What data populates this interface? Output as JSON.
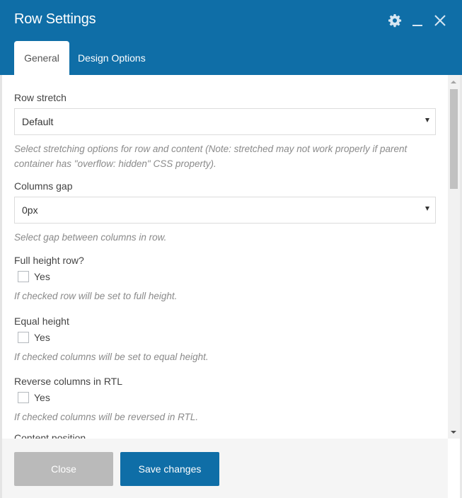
{
  "window": {
    "title": "Row Settings",
    "icons": [
      "gear-icon",
      "minimize-icon",
      "close-icon"
    ]
  },
  "tabs": [
    {
      "label": "General",
      "active": true
    },
    {
      "label": "Design Options",
      "active": false
    }
  ],
  "fields": {
    "row_stretch": {
      "label": "Row stretch",
      "value": "Default",
      "hint": "Select stretching options for row and content (Note: stretched may not work properly if parent container has \"overflow: hidden\" CSS property)."
    },
    "columns_gap": {
      "label": "Columns gap",
      "value": "0px",
      "hint": "Select gap between columns in row."
    },
    "full_height": {
      "label": "Full height row?",
      "option": "Yes",
      "checked": false,
      "hint": "If checked row will be set to full height."
    },
    "equal_height": {
      "label": "Equal height",
      "option": "Yes",
      "checked": false,
      "hint": "If checked columns will be set to equal height."
    },
    "reverse_rtl": {
      "label": "Reverse columns in RTL",
      "option": "Yes",
      "checked": false,
      "hint": "If checked columns will be reversed in RTL."
    },
    "content_position": {
      "label": "Content position"
    }
  },
  "footer": {
    "close_label": "Close",
    "save_label": "Save changes"
  },
  "colors": {
    "brand": "#0f6ea7",
    "close_button": "#bababa"
  }
}
